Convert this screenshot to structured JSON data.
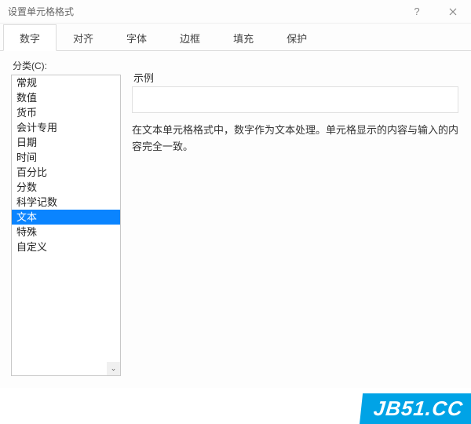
{
  "window": {
    "title": "设置单元格格式"
  },
  "tabs": [
    {
      "label": "数字",
      "active": true
    },
    {
      "label": "对齐",
      "active": false
    },
    {
      "label": "字体",
      "active": false
    },
    {
      "label": "边框",
      "active": false
    },
    {
      "label": "填充",
      "active": false
    },
    {
      "label": "保护",
      "active": false
    }
  ],
  "left": {
    "category_label": "分类(C):",
    "items": [
      "常规",
      "数值",
      "货币",
      "会计专用",
      "日期",
      "时间",
      "百分比",
      "分数",
      "科学记数",
      "文本",
      "特殊",
      "自定义"
    ],
    "selected_index": 9
  },
  "right": {
    "sample_label": "示例",
    "sample_value": "",
    "description": "在文本单元格格式中，数字作为文本处理。单元格显示的内容与输入的内容完全一致。"
  },
  "watermark": "JB51.CC"
}
